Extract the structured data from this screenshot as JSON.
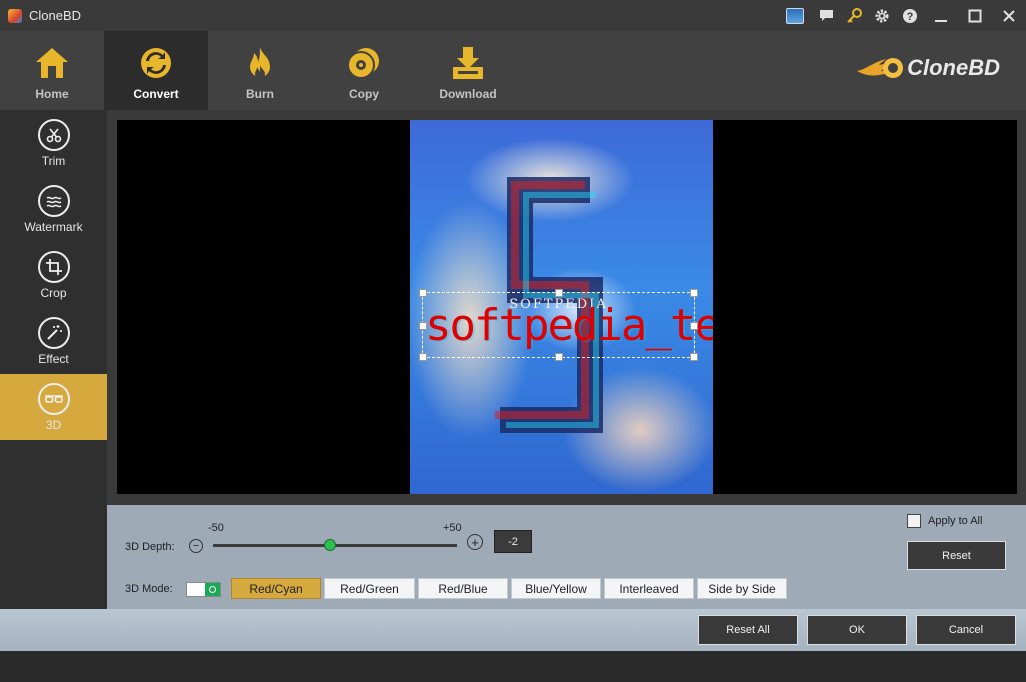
{
  "window": {
    "title": "CloneBD"
  },
  "titlebar_icons": [
    "flag-icon",
    "chat-icon",
    "key-icon",
    "gear-icon",
    "help-icon",
    "minimize-icon",
    "maximize-icon",
    "close-icon"
  ],
  "nav": {
    "items": [
      {
        "label": "Home",
        "icon": "home-icon"
      },
      {
        "label": "Convert",
        "icon": "convert-icon",
        "active": true
      },
      {
        "label": "Burn",
        "icon": "flame-icon"
      },
      {
        "label": "Copy",
        "icon": "disc-icon"
      },
      {
        "label": "Download",
        "icon": "download-icon"
      }
    ],
    "brand": "CloneBD"
  },
  "sidebar": {
    "items": [
      {
        "label": "Trim",
        "icon": "scissors-icon"
      },
      {
        "label": "Watermark",
        "icon": "watermark-icon"
      },
      {
        "label": "Crop",
        "icon": "crop-icon"
      },
      {
        "label": "Effect",
        "icon": "magic-wand-icon"
      },
      {
        "label": "3D",
        "icon": "3d-glasses-icon",
        "active": true
      }
    ]
  },
  "preview": {
    "watermark_small": "SOFTPEDIA",
    "watermark_text": "softpedia_test"
  },
  "controls": {
    "depth_label": "3D Depth:",
    "min_label": "-50",
    "max_label": "+50",
    "depth_value": "-2",
    "depth_fraction": 0.48,
    "mode_label": "3D Mode:",
    "modes": [
      "Red/Cyan",
      "Red/Green",
      "Red/Blue",
      "Blue/Yellow",
      "Interleaved",
      "Side by Side"
    ],
    "active_mode": "Red/Cyan",
    "apply_all_label": "Apply to All",
    "apply_all_checked": false,
    "reset_label": "Reset"
  },
  "footer": {
    "reset_all_label": "Reset All",
    "ok_label": "OK",
    "cancel_label": "Cancel"
  },
  "colors": {
    "accent": "#d6a93e",
    "slider_thumb": "#29c04b",
    "watermark_text": "#e00000"
  }
}
